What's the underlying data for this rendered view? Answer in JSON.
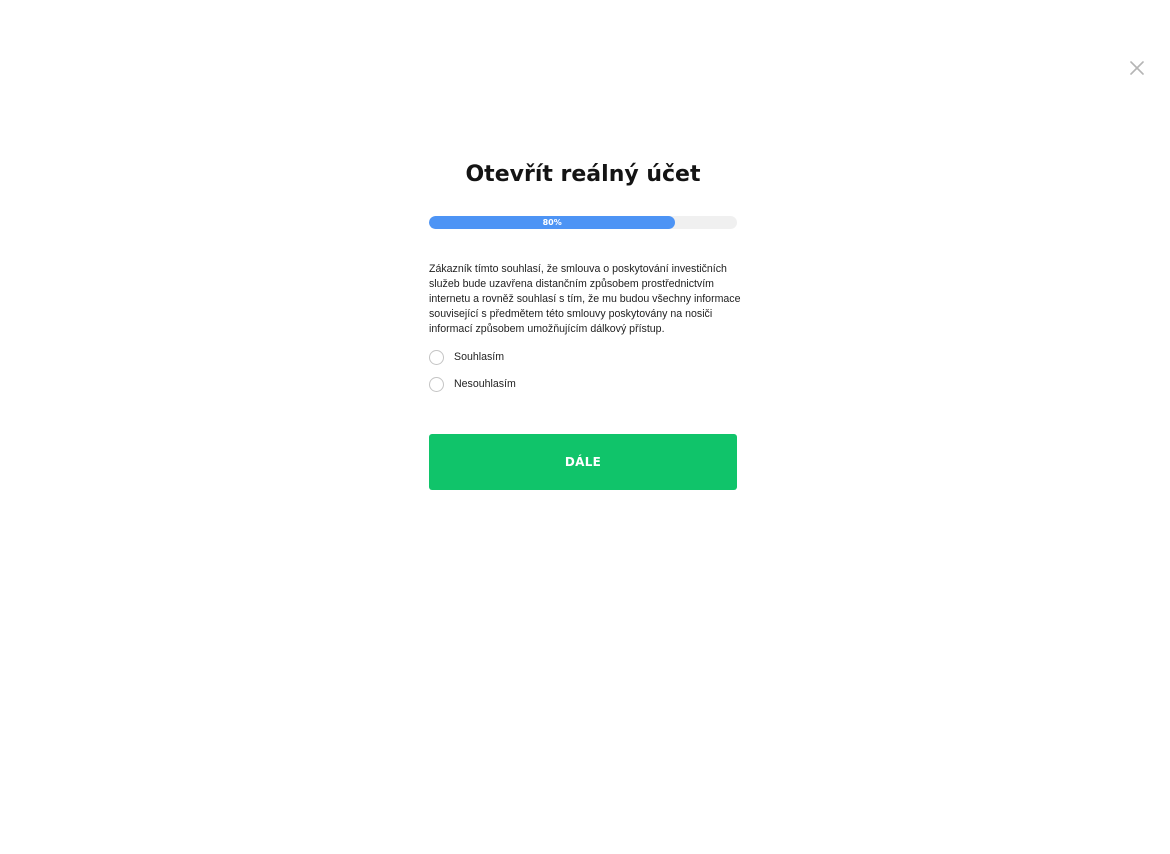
{
  "modal": {
    "title": "Otevřít reálný účet",
    "close_icon": "close-icon"
  },
  "progress": {
    "value_percent": 80,
    "fill_fraction": 0.8,
    "label": "80%",
    "fill_color": "#4d94f5",
    "track_color": "#f0f0f0"
  },
  "consent": {
    "text": "Zákazník tímto souhlasí, že smlouva o poskytování investičních služeb bude uzavřena distančním způsobem prostřednictvím internetu a rovněž souhlasí s tím, že mu budou všechny informace související s předmětem této smlouvy poskytovány na nosiči informací způsobem umožňujícím dálkový přístup.",
    "options": [
      {
        "label": "Souhlasím",
        "selected": false
      },
      {
        "label": "Nesouhlasím",
        "selected": false
      }
    ]
  },
  "actions": {
    "next_label": "DÁLE",
    "next_color": "#10c46a"
  }
}
